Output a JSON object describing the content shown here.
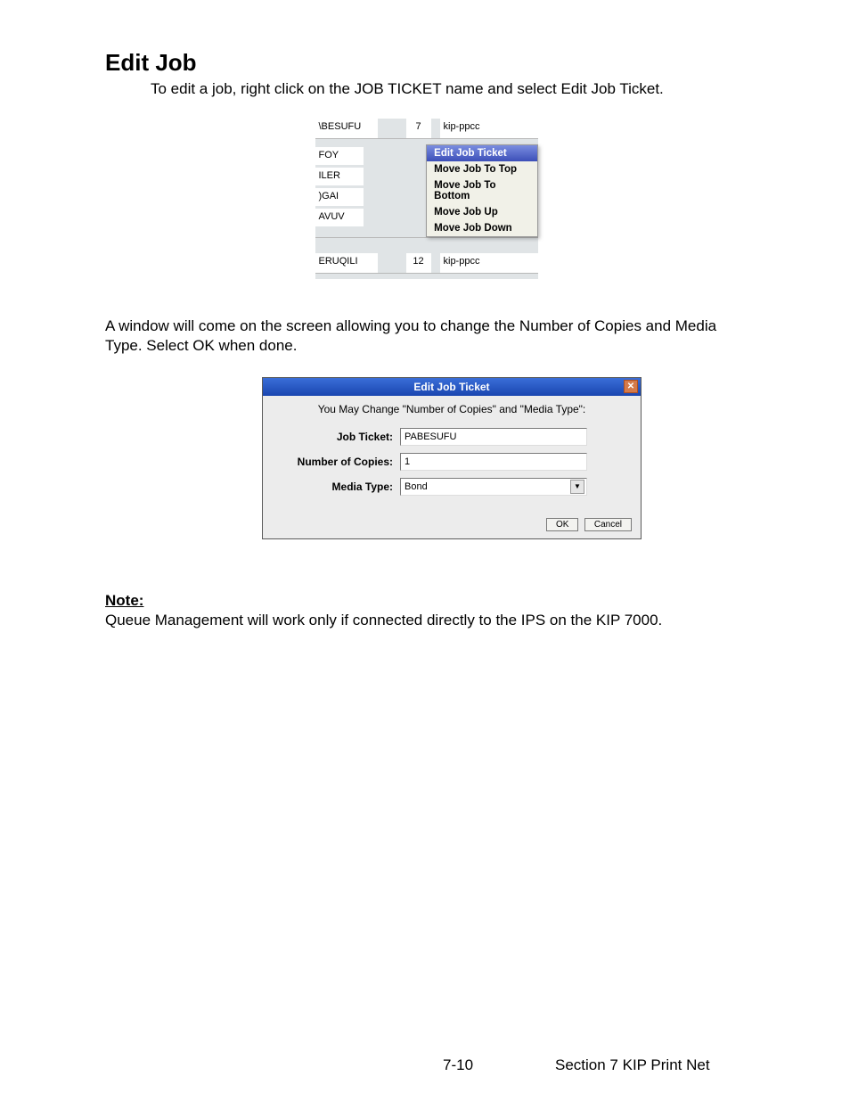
{
  "heading": "Edit Job",
  "intro": "To edit a job, right click on the JOB TICKET name and select Edit Job Ticket.",
  "context_table": {
    "top_row": {
      "name": "\\BESUFU",
      "num": "7",
      "text": "kip-ppcc"
    },
    "left_labels": [
      "FOY",
      "ILER",
      ")GAI",
      "AVUV"
    ],
    "menu": [
      "Edit Job Ticket",
      "Move Job To Top",
      "Move Job To Bottom",
      "Move Job Up",
      "Move Job Down"
    ],
    "bottom_row": {
      "name": "ERUQILI",
      "num": "12",
      "text": "kip-ppcc"
    }
  },
  "para2": "A window will come on the screen allowing you to change the Number of Copies and Media Type. Select OK when done.",
  "dialog": {
    "title": "Edit Job Ticket",
    "instruction": "You May Change \"Number of Copies\" and \"Media Type\":",
    "labels": {
      "job_ticket": "Job Ticket:",
      "copies": "Number of Copies:",
      "media": "Media Type:"
    },
    "values": {
      "job_ticket": "PABESUFU",
      "copies": "1",
      "media": "Bond"
    },
    "ok": "OK",
    "cancel": "Cancel"
  },
  "note_label": "Note:",
  "note_text": "Queue Management will work only if connected directly to the IPS on the KIP 7000.",
  "footer": {
    "page": "7-10",
    "section": "Section 7   KIP Print Net"
  }
}
